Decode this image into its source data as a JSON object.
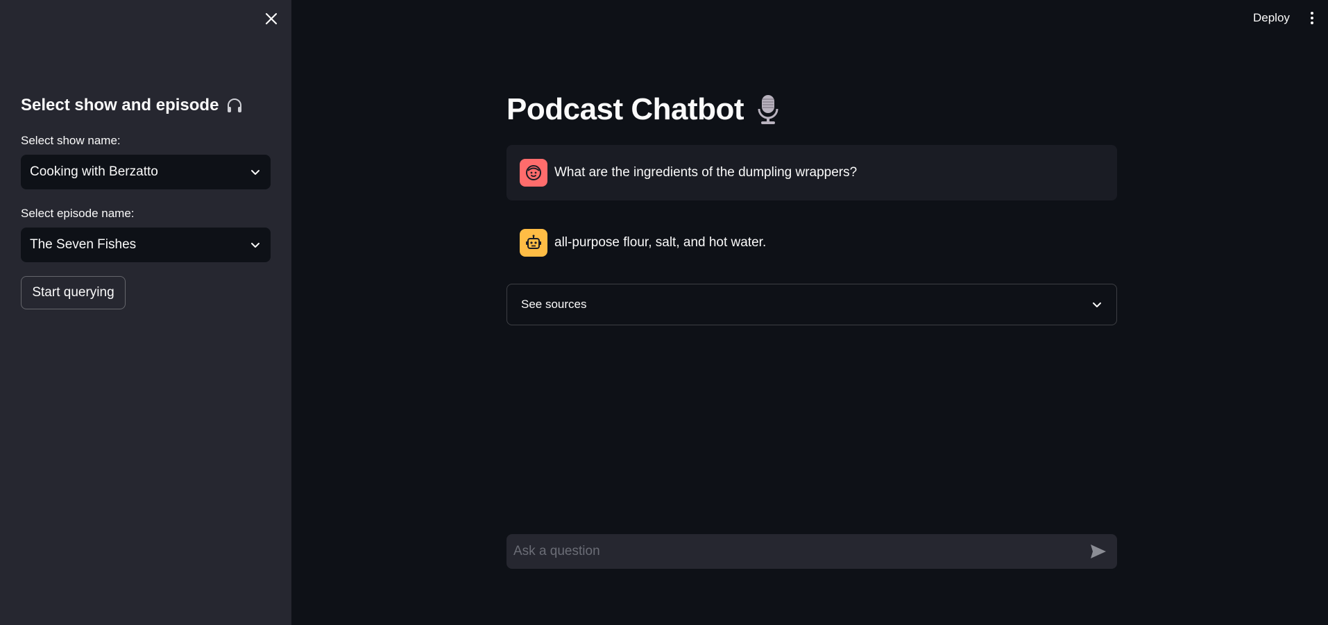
{
  "header": {
    "deploy_label": "Deploy",
    "menu_icon": "more-vertical-icon"
  },
  "sidebar": {
    "close_icon": "close-icon",
    "heading": "Select show and episode",
    "heading_icon": "headphones-icon",
    "show_label": "Select show name:",
    "show_value": "Cooking with Berzatto",
    "episode_label": "Select episode name:",
    "episode_value": "The Seven Fishes",
    "start_button": "Start querying"
  },
  "main": {
    "title": "Podcast Chatbot",
    "title_icon": "microphone-icon",
    "messages": [
      {
        "role": "user",
        "avatar": "user-face-icon",
        "avatar_color": "#ff6c6c",
        "text": "What are the ingredients of the dumpling wrappers?"
      },
      {
        "role": "assistant",
        "avatar": "robot-icon",
        "avatar_color": "#ffbd45",
        "text": "all-purpose flour, salt, and hot water."
      }
    ],
    "sources_expander": "See sources",
    "chat_input": {
      "placeholder": "Ask a question",
      "value": ""
    }
  },
  "colors": {
    "background": "#0e1117",
    "sidebar": "#262730",
    "text": "#fafafa"
  }
}
